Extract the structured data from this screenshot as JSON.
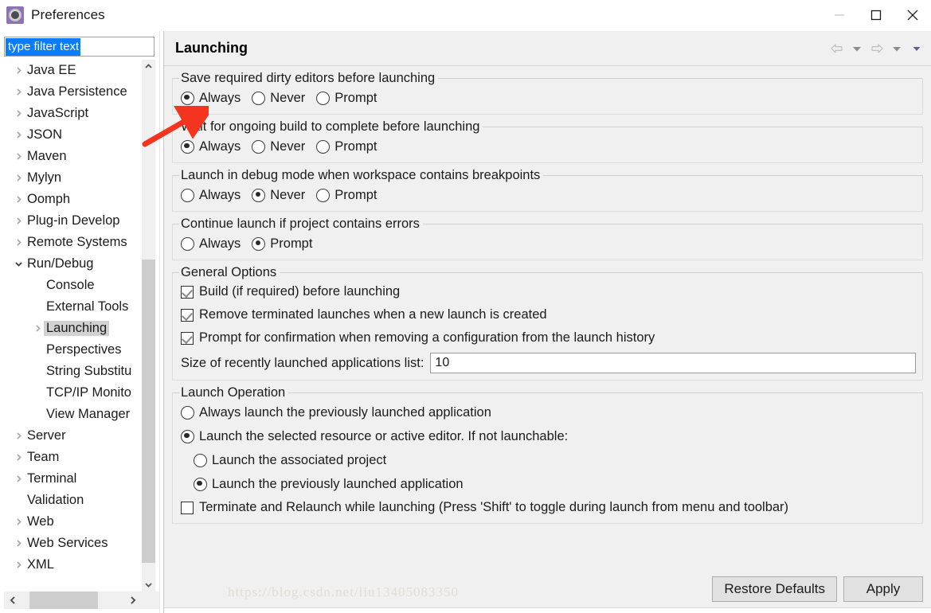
{
  "window": {
    "title": "Preferences",
    "icon": "gear-icon",
    "controls": {
      "minimize": "minimize-icon",
      "maximize": "maximize-icon",
      "close": "close-icon"
    }
  },
  "sidebar": {
    "filter": {
      "value": "type filter text",
      "placeholder": "type filter text",
      "selected": true
    },
    "items": [
      {
        "label": "Java EE",
        "expandable": true,
        "expanded": false,
        "child": false,
        "selected": false
      },
      {
        "label": "Java Persistence",
        "expandable": true,
        "expanded": false,
        "child": false,
        "selected": false
      },
      {
        "label": "JavaScript",
        "expandable": true,
        "expanded": false,
        "child": false,
        "selected": false
      },
      {
        "label": "JSON",
        "expandable": true,
        "expanded": false,
        "child": false,
        "selected": false
      },
      {
        "label": "Maven",
        "expandable": true,
        "expanded": false,
        "child": false,
        "selected": false
      },
      {
        "label": "Mylyn",
        "expandable": true,
        "expanded": false,
        "child": false,
        "selected": false
      },
      {
        "label": "Oomph",
        "expandable": true,
        "expanded": false,
        "child": false,
        "selected": false
      },
      {
        "label": "Plug-in Develop",
        "expandable": true,
        "expanded": false,
        "child": false,
        "selected": false
      },
      {
        "label": "Remote Systems",
        "expandable": true,
        "expanded": false,
        "child": false,
        "selected": false
      },
      {
        "label": "Run/Debug",
        "expandable": true,
        "expanded": true,
        "child": false,
        "selected": false
      },
      {
        "label": "Console",
        "expandable": false,
        "expanded": false,
        "child": true,
        "selected": false
      },
      {
        "label": "External Tools",
        "expandable": false,
        "expanded": false,
        "child": true,
        "selected": false
      },
      {
        "label": "Launching",
        "expandable": true,
        "expanded": false,
        "child": true,
        "selected": true
      },
      {
        "label": "Perspectives",
        "expandable": false,
        "expanded": false,
        "child": true,
        "selected": false
      },
      {
        "label": "String Substitu",
        "expandable": false,
        "expanded": false,
        "child": true,
        "selected": false
      },
      {
        "label": "TCP/IP Monito",
        "expandable": false,
        "expanded": false,
        "child": true,
        "selected": false
      },
      {
        "label": "View Manager",
        "expandable": false,
        "expanded": false,
        "child": true,
        "selected": false
      },
      {
        "label": "Server",
        "expandable": true,
        "expanded": false,
        "child": false,
        "selected": false
      },
      {
        "label": "Team",
        "expandable": true,
        "expanded": false,
        "child": false,
        "selected": false
      },
      {
        "label": "Terminal",
        "expandable": true,
        "expanded": false,
        "child": false,
        "selected": false
      },
      {
        "label": "Validation",
        "expandable": false,
        "expanded": false,
        "child": false,
        "selected": false
      },
      {
        "label": "Web",
        "expandable": true,
        "expanded": false,
        "child": false,
        "selected": false
      },
      {
        "label": "Web Services",
        "expandable": true,
        "expanded": false,
        "child": false,
        "selected": false
      },
      {
        "label": "XML",
        "expandable": true,
        "expanded": false,
        "child": false,
        "selected": false
      }
    ]
  },
  "page": {
    "title": "Launching",
    "nav": [
      {
        "name": "back-arrow-icon",
        "kind": "arrow-left"
      },
      {
        "name": "back-dropdown-icon",
        "kind": "chevron"
      },
      {
        "name": "forward-arrow-icon",
        "kind": "arrow-right"
      },
      {
        "name": "forward-dropdown-icon",
        "kind": "chevron"
      },
      {
        "name": "view-menu-icon",
        "kind": "chevron-purple"
      }
    ],
    "groups": {
      "save_dirty": {
        "legend": "Save required dirty editors before launching",
        "options": [
          {
            "label": "Always",
            "selected": true
          },
          {
            "label": "Never",
            "selected": false
          },
          {
            "label": "Prompt",
            "selected": false
          }
        ]
      },
      "wait_build": {
        "legend": "Wait for ongoing build to complete before launching",
        "options": [
          {
            "label": "Always",
            "selected": true
          },
          {
            "label": "Never",
            "selected": false
          },
          {
            "label": "Prompt",
            "selected": false
          }
        ]
      },
      "debug_breakpoints": {
        "legend": "Launch in debug mode when workspace contains breakpoints",
        "options": [
          {
            "label": "Always",
            "selected": false
          },
          {
            "label": "Never",
            "selected": true
          },
          {
            "label": "Prompt",
            "selected": false
          }
        ]
      },
      "continue_errors": {
        "legend": "Continue launch if project contains errors",
        "options": [
          {
            "label": "Always",
            "selected": false
          },
          {
            "label": "Prompt",
            "selected": true
          }
        ]
      },
      "general_options": {
        "legend": "General Options",
        "checkboxes": [
          {
            "label": "Build (if required) before launching",
            "checked": true
          },
          {
            "label": "Remove terminated launches when a new launch is created",
            "checked": true
          },
          {
            "label": "Prompt for confirmation when removing a configuration from the launch history",
            "checked": true
          }
        ],
        "size_field": {
          "label": "Size of recently launched applications list:",
          "value": "10",
          "placeholder": ""
        }
      },
      "launch_operation": {
        "legend": "Launch Operation",
        "options": [
          {
            "label": "Always launch the previously launched application",
            "selected": false,
            "indent": 0
          },
          {
            "label": "Launch the selected resource or active editor. If not launchable:",
            "selected": true,
            "indent": 0
          },
          {
            "label": "Launch the associated project",
            "selected": false,
            "indent": 1
          },
          {
            "label": "Launch the previously launched application",
            "selected": true,
            "indent": 1
          }
        ],
        "terminate_checkbox": {
          "label": "Terminate and Relaunch while launching (Press 'Shift' to toggle during launch from menu and toolbar)",
          "checked": false
        }
      }
    }
  },
  "footer": {
    "restore_defaults": "Restore Defaults",
    "apply": "Apply",
    "watermark": "https://blog.csdn.net/liu13405083350"
  },
  "annotation": {
    "arrow_color": "#f5341f",
    "points_at": "save-dirty-always-radio"
  }
}
